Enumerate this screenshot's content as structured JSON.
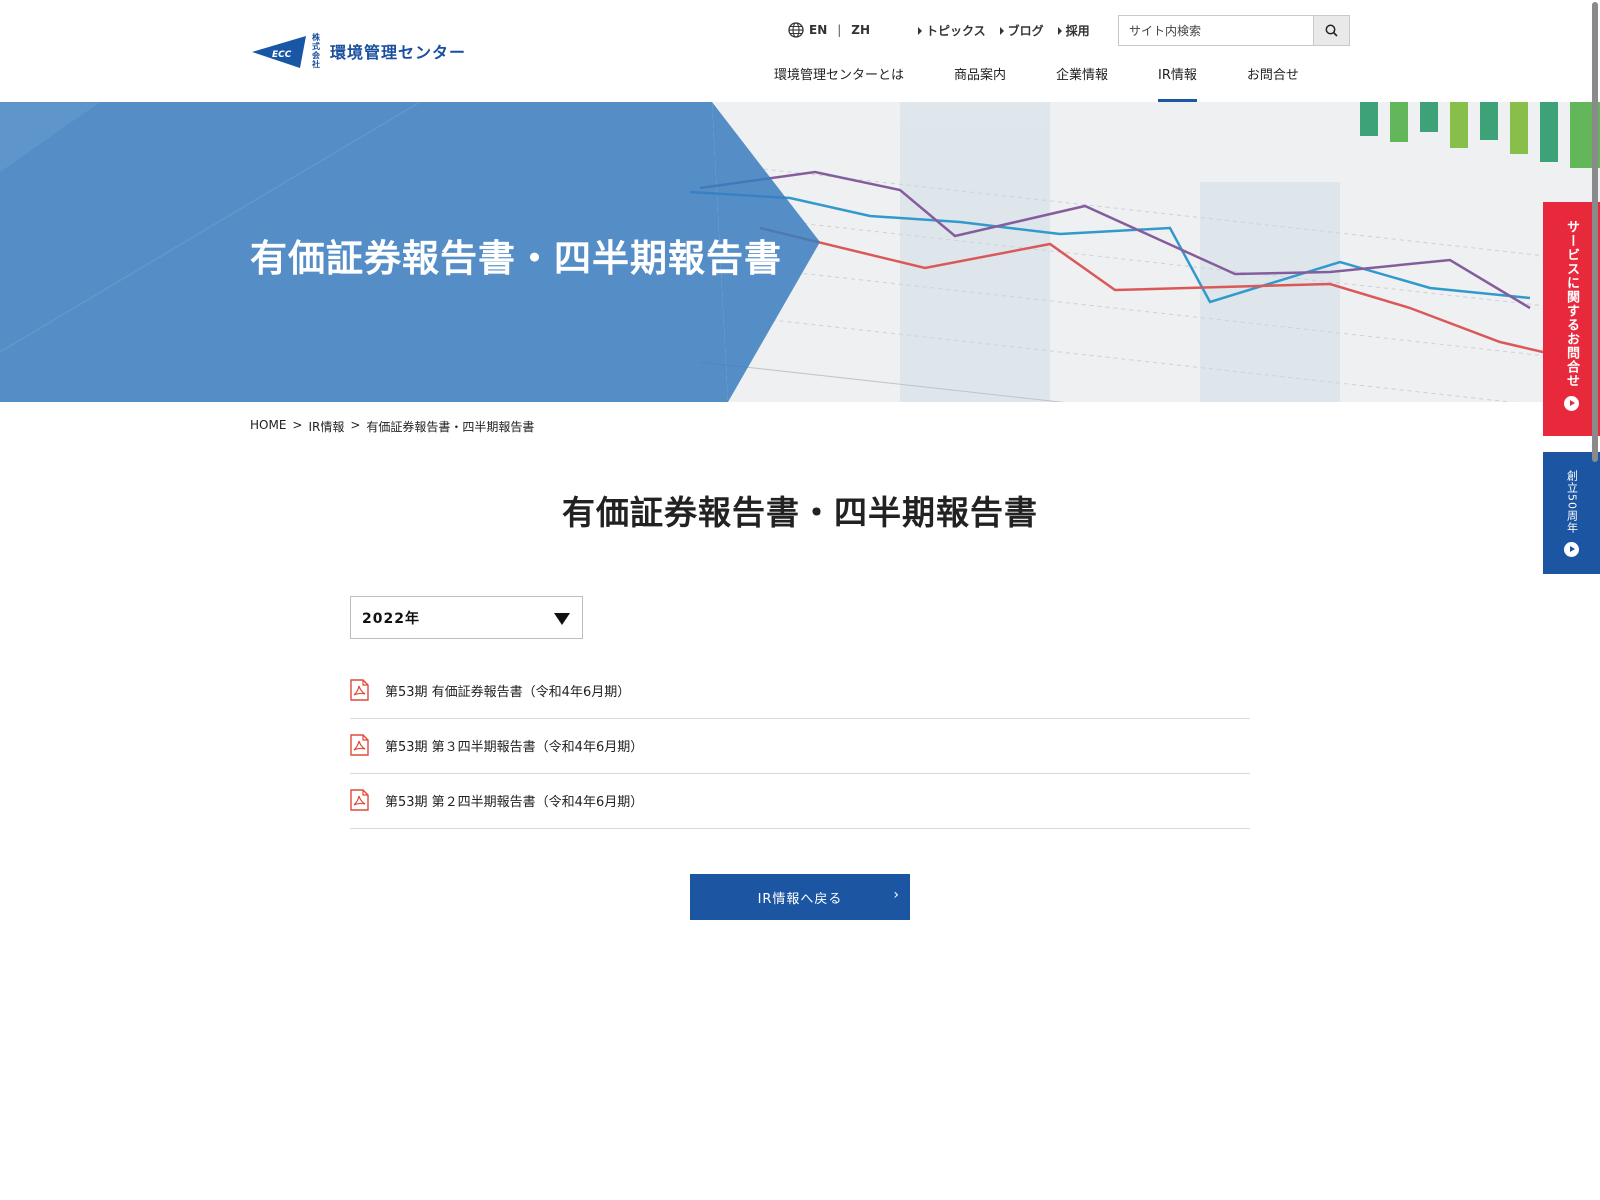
{
  "header": {
    "logo": {
      "mark_text": "ECC",
      "corp_text": "株式会社",
      "name": "環境管理センター"
    },
    "lang": {
      "en": "EN",
      "zh": "ZH"
    },
    "util_links": [
      "トピックス",
      "ブログ",
      "採用"
    ],
    "search": {
      "placeholder": "サイト内検索"
    },
    "nav": [
      "環境管理センターとは",
      "商品案内",
      "企業情報",
      "IR情報",
      "お問合せ"
    ]
  },
  "hero": {
    "title": "有価証券報告書・四半期報告書"
  },
  "side_tabs": {
    "contact": "サービスに関するお問合せ",
    "anniversary": "創立50周年"
  },
  "breadcrumb": [
    "HOME",
    ">",
    "IR情報",
    ">",
    "有価証券報告書・四半期報告書"
  ],
  "page_title": "有価証券報告書・四半期報告書",
  "year_select": {
    "value": "2022年"
  },
  "documents": [
    "第53期 有価証券報告書（令和4年6月期）",
    "第53期 第３四半期報告書（令和4年6月期）",
    "第53期 第２四半期報告書（令和4年6月期）"
  ],
  "back_button": "IR情報へ戻る",
  "colors": {
    "brand_blue": "#1c56a3",
    "contact_red": "#e8293b",
    "hero_overlay": "#3a7dc0"
  }
}
